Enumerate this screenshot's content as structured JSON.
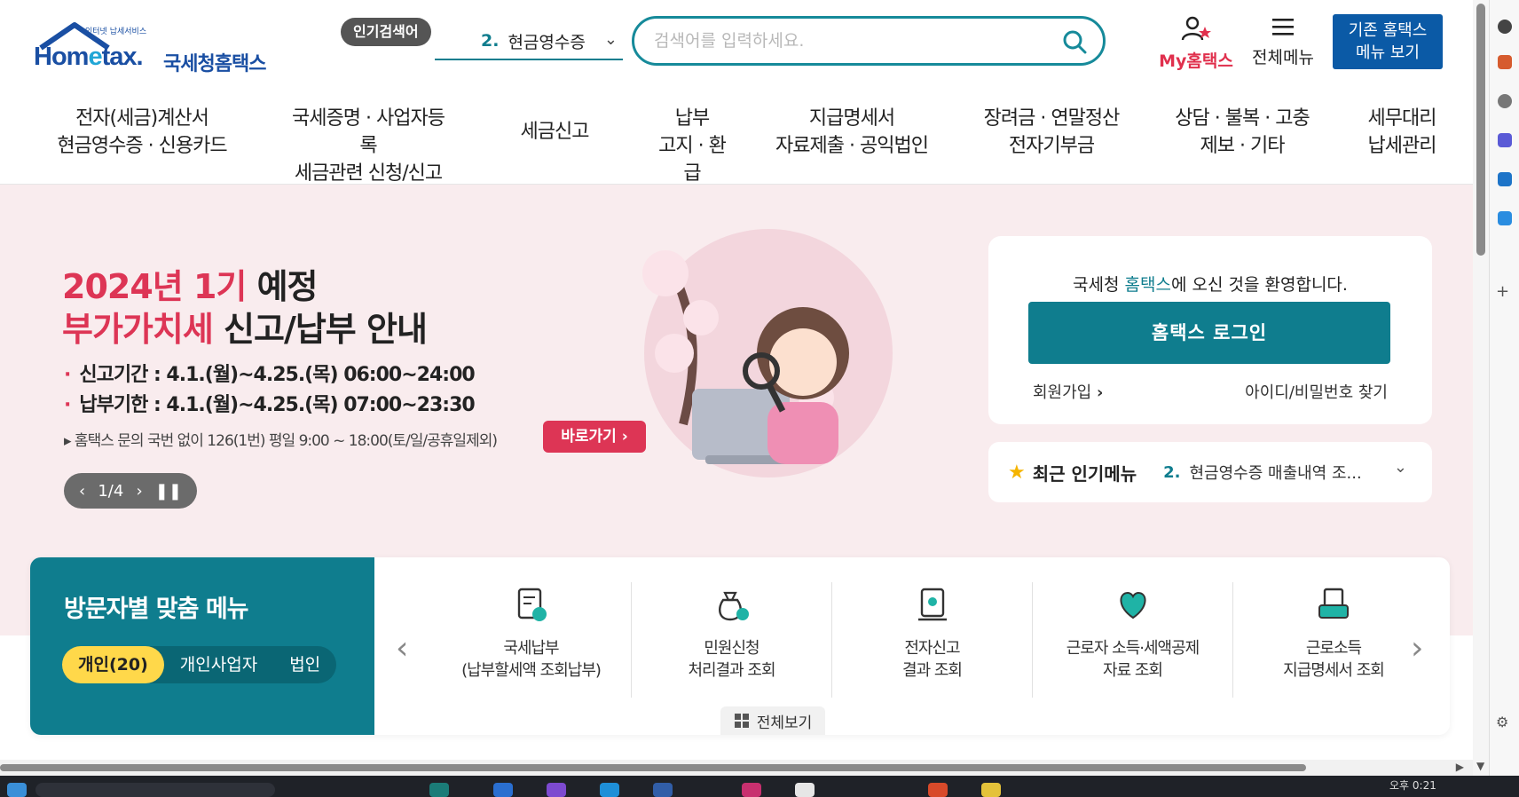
{
  "header": {
    "logo": {
      "mini_text": "인터넷 납세서비스",
      "wordmark_pre": "Hom",
      "wordmark_e": "e",
      "wordmark_post": "tax.",
      "name": "국세청홈택스"
    },
    "popular_badge": "인기검색어",
    "popular_select": {
      "number": "2.",
      "value": "현금영수증"
    },
    "search": {
      "placeholder": "검색어를 입력하세요."
    },
    "my_hometax": "My홈택스",
    "all_menu": "전체메뉴",
    "old_menu": "기존 홈택스\n메뉴 보기"
  },
  "gnb": [
    "전자(세금)계산서\n현금영수증 · 신용카드",
    "국세증명 · 사업자등록\n세금관련 신청/신고",
    "세금신고",
    "납부\n고지 · 환급",
    "지급명세서\n자료제출 · 공익법인",
    "장려금 · 연말정산\n전자기부금",
    "상담 · 불복 · 고충\n제보 · 기타",
    "세무대리\n납세관리"
  ],
  "hero": {
    "title1_red": "2024년 1기",
    "title1_dark": " 예정",
    "title2_red": "부가가치세",
    "title2_dark": " 신고/납부 안내",
    "line1": "신고기간 : 4.1.(월)~4.25.(목) 06:00~24:00",
    "line2": "납부기한 : 4.1.(월)~4.25.(목) 07:00~23:30",
    "note": "▸ 홈택스 문의 국번 없이 126(1번) 평일 9:00 ~ 18:00(토/일/공휴일제외)",
    "go_button": "바로가기",
    "pager": "1/4"
  },
  "login": {
    "welcome_pre": "국세청 ",
    "welcome_hl": "홈택스",
    "welcome_post": "에 오신 것을 환영합니다.",
    "login_button": "홈택스 로그인",
    "join": "회원가입",
    "find": "아이디/비밀번호 찾기"
  },
  "recent": {
    "title": "최근 인기메뉴",
    "number": "2.",
    "value": "현금영수증 매출내역 조..."
  },
  "visitor": {
    "title": "방문자별 맞춤 메뉴",
    "tabs": [
      "개인(20)",
      "개인사업자",
      "법인"
    ],
    "cards": [
      {
        "label": "국세납부\n(납부할세액 조회납부)",
        "icon": "document-payment-icon"
      },
      {
        "label": "민원신청\n처리결과 조회",
        "icon": "money-bag-icon"
      },
      {
        "label": "전자신고\n결과 조회",
        "icon": "certificate-icon"
      },
      {
        "label": "근로자 소득·세액공제\n자료 조회",
        "icon": "heart-hands-icon"
      },
      {
        "label": "근로소득\n지급명세서 조회",
        "icon": "tray-document-icon"
      }
    ],
    "view_all": "전체보기"
  },
  "taskbar": {
    "clock": "오후 0:21"
  },
  "colors": {
    "teal": "#0f7d8e",
    "red": "#dd3555",
    "navy": "#0b5aa6",
    "yellow": "#ffd84a",
    "hero_bg": "#f9ecee"
  }
}
